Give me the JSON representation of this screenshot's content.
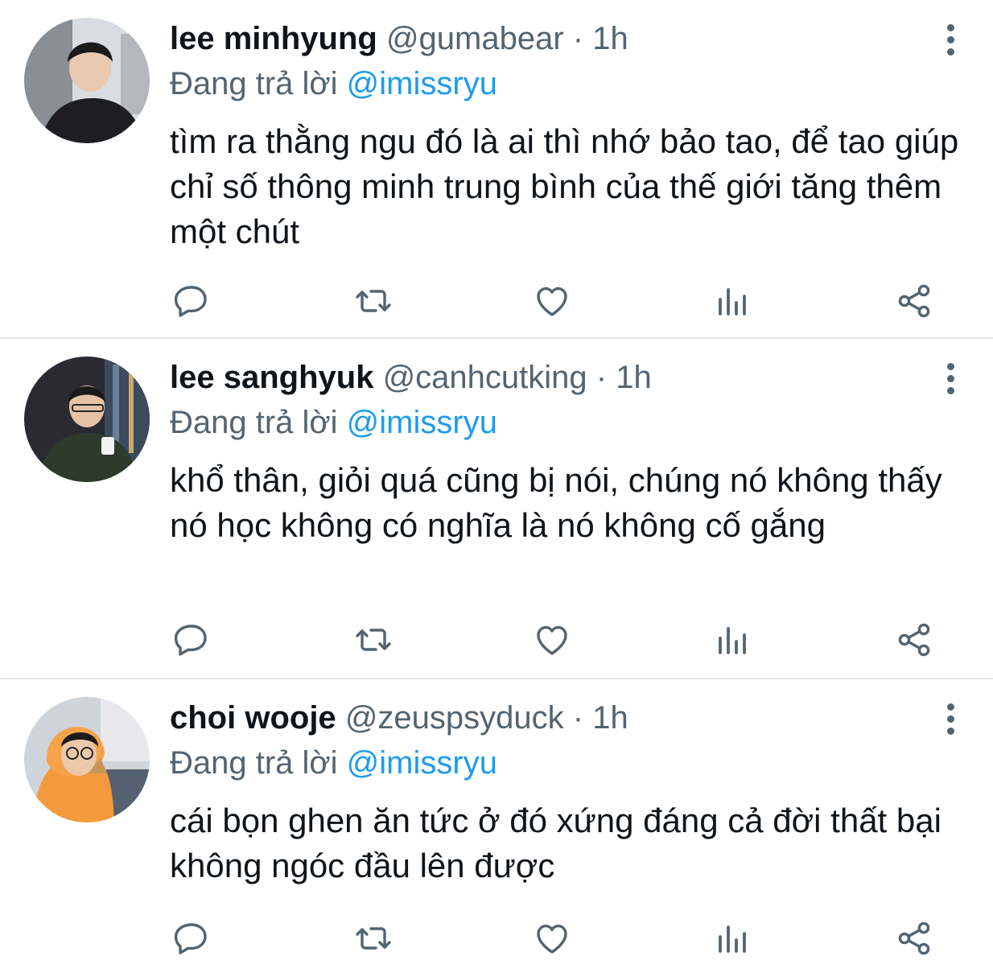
{
  "tweets": [
    {
      "name": "lee minhyung",
      "handle": "@gumabear",
      "separator": "·",
      "time": "1h",
      "reply_prefix": "Đang trả lời",
      "reply_to": "@imissryu",
      "text": "tìm ra thằng ngu đó là ai thì nhớ bảo tao, để tao giúp chỉ số thông minh trung bình của thế giới tăng thêm một chút"
    },
    {
      "name": "lee sanghyuk",
      "handle": "@canhcutking",
      "separator": "·",
      "time": "1h",
      "reply_prefix": "Đang trả lời",
      "reply_to": "@imissryu",
      "text": "khổ thân, giỏi quá cũng bị nói, chúng nó không thấy nó học không có nghĩa là nó không cố gắng"
    },
    {
      "name": "choi wooje",
      "handle": "@zeuspsyduck",
      "separator": "·",
      "time": "1h",
      "reply_prefix": "Đang trả lời",
      "reply_to": "@imissryu",
      "text": "cái bọn ghen ăn tức ở đó xứng đáng cả đời thất bại không ngóc đầu lên được"
    }
  ],
  "icons": {
    "more": "more-vertical-icon",
    "reply": "reply-bubble-icon",
    "retweet": "retweet-icon",
    "like": "heart-icon",
    "views": "bar-chart-icon",
    "share": "share-icon"
  },
  "colors": {
    "text": "#0f1419",
    "secondary": "#536471",
    "mention": "#1d9bf0",
    "divider": "#e3e6e9"
  }
}
